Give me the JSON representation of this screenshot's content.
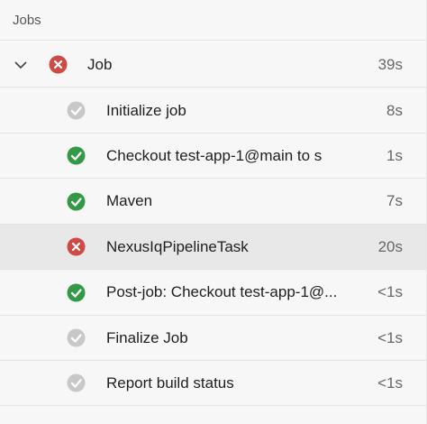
{
  "header": {
    "title": "Jobs"
  },
  "job": {
    "label": "Job",
    "duration": "39s",
    "status": "failed",
    "expanded": true
  },
  "steps": [
    {
      "label": "Initialize job",
      "duration": "8s",
      "status": "skipped"
    },
    {
      "label": "Checkout test-app-1@main to s",
      "duration": "1s",
      "status": "succeeded"
    },
    {
      "label": "Maven",
      "duration": "7s",
      "status": "succeeded"
    },
    {
      "label": "NexusIqPipelineTask",
      "duration": "20s",
      "status": "failed",
      "selected": true
    },
    {
      "label": "Post-job: Checkout test-app-1@...",
      "duration": "<1s",
      "status": "succeeded"
    },
    {
      "label": "Finalize Job",
      "duration": "<1s",
      "status": "skipped"
    },
    {
      "label": "Report build status",
      "duration": "<1s",
      "status": "skipped"
    }
  ],
  "colors": {
    "failed": "#cd4a45",
    "succeeded": "#339947",
    "skipped": "#c8c8c8",
    "selected_row": "#e8e8e8"
  },
  "icons": {
    "failed": "error-x-icon",
    "succeeded": "checkmark-icon",
    "skipped": "skipped-checkmark-icon",
    "expand": "chevron-down-icon"
  }
}
